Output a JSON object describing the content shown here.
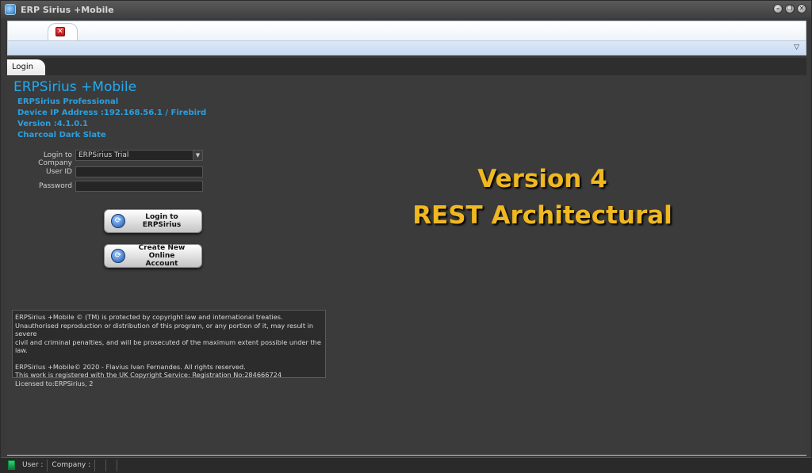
{
  "window": {
    "title": "ERP Sirius +Mobile"
  },
  "title_buttons": {
    "minimize": "–",
    "restore": "❐",
    "close": "✕"
  },
  "ribbon": {
    "close_glyph": "✕",
    "collapse_glyph": "▽"
  },
  "tabs": {
    "login_label": "Login"
  },
  "brand": {
    "title": "ERPSirius +Mobile",
    "lines": [
      "ERPSirius Professional",
      "Device IP Address :192.168.56.1  / Firebird",
      "Version :4.1.0.1",
      "Charcoal Dark Slate"
    ]
  },
  "form": {
    "company_label": "Login to Company",
    "company_value": "ERPSirius Trial",
    "user_id_label": "User ID",
    "user_id_value": "",
    "password_label": "Password",
    "password_value": ""
  },
  "buttons": {
    "login": "Login to ERPSirius",
    "create_line1": "Create New Online",
    "create_line2": "Account"
  },
  "legal": {
    "line1": "ERPSirius +Mobile © (TM)  is protected by copyright law and international treaties.",
    "line2": "Unauthorised reproduction or distribution of this program, or any portion of it, may result in  severe",
    "line3": "civil and criminal penalties, and will be prosecuted of the maximum extent possible under the law.",
    "line4": "ERPSirius +Mobile© 2020 -  Flavius Ivan Fernandes. All rights reserved.",
    "line5": "This work is registered with the UK Copyright Service: Registration No:284666724",
    "line6": "Licensed to:ERPSirius, 2"
  },
  "promo": {
    "line1": "Version 4",
    "line2": "REST Architectural"
  },
  "statusbar": {
    "user_label": "User :",
    "company_label": "Company :"
  },
  "icons": {
    "app": "app-logo-icon",
    "ribbon_close": "close-icon",
    "collapse": "chevron-down-icon",
    "button": "refresh-arrow-icon",
    "status": "door-icon"
  },
  "colors": {
    "brand_blue": "#2aa8e8",
    "promo_gold": "#f0b820",
    "background": "#3b3b3b"
  }
}
